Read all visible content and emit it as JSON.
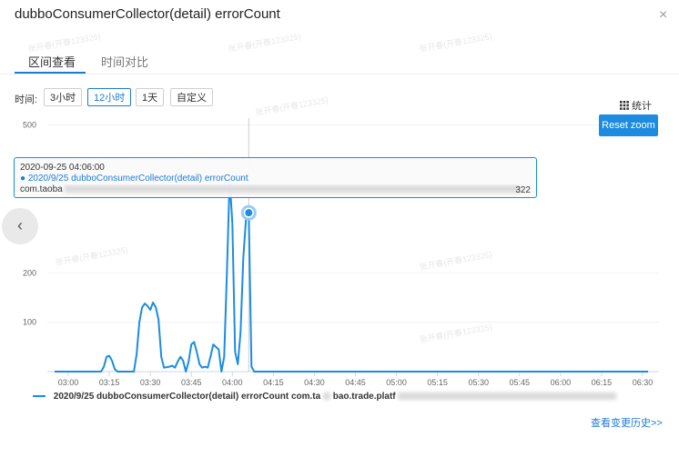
{
  "dialog": {
    "title": "dubboConsumerCollector(detail) errorCount",
    "close_glyph": "×"
  },
  "tabs": [
    {
      "label": "区间查看",
      "active": true
    },
    {
      "label": "时间对比",
      "active": false
    }
  ],
  "toolbar": {
    "time_label": "时间:",
    "ranges": [
      {
        "label": "3小时",
        "active": false
      },
      {
        "label": "12小时",
        "active": true
      },
      {
        "label": "1天",
        "active": false
      },
      {
        "label": "自定义",
        "active": false
      }
    ],
    "stats_label": "统计",
    "stats_icon": "grid-icon",
    "reset_zoom": "Reset zoom"
  },
  "nav": {
    "prev_glyph": "‹"
  },
  "chart_data": {
    "type": "line",
    "color": "#1d8ce0",
    "y_ticks": [
      "100",
      "200",
      "500"
    ],
    "x_ticks": [
      "03:00",
      "03:15",
      "03:30",
      "03:45",
      "04:00",
      "04:15",
      "04:30",
      "04:45",
      "05:00",
      "05:15",
      "05:30",
      "05:45",
      "06:00",
      "06:15",
      "06:30"
    ],
    "x_start": "02:55",
    "x_end": "06:32",
    "series": [
      {
        "name": "2020/9/25 dubboConsumerCollector(detail) errorCount com.taobao.trade.platf",
        "points": [
          [
            "02:55",
            0
          ],
          [
            "03:12",
            0
          ],
          [
            "03:13",
            10
          ],
          [
            "03:14",
            30
          ],
          [
            "03:15",
            32
          ],
          [
            "03:16",
            22
          ],
          [
            "03:17",
            5
          ],
          [
            "03:18",
            0
          ],
          [
            "03:24",
            0
          ],
          [
            "03:25",
            35
          ],
          [
            "03:26",
            100
          ],
          [
            "03:27",
            130
          ],
          [
            "03:28",
            138
          ],
          [
            "03:29",
            133
          ],
          [
            "03:30",
            125
          ],
          [
            "03:31",
            140
          ],
          [
            "03:32",
            130
          ],
          [
            "03:33",
            105
          ],
          [
            "03:34",
            30
          ],
          [
            "03:35",
            8
          ],
          [
            "03:37",
            10
          ],
          [
            "03:38",
            12
          ],
          [
            "03:39",
            8
          ],
          [
            "03:40",
            20
          ],
          [
            "03:41",
            30
          ],
          [
            "03:42",
            22
          ],
          [
            "03:43",
            0
          ],
          [
            "03:44",
            20
          ],
          [
            "03:45",
            55
          ],
          [
            "03:46",
            60
          ],
          [
            "03:47",
            40
          ],
          [
            "03:48",
            15
          ],
          [
            "03:49",
            8
          ],
          [
            "03:50",
            10
          ],
          [
            "03:51",
            8
          ],
          [
            "03:52",
            30
          ],
          [
            "03:53",
            55
          ],
          [
            "03:54",
            50
          ],
          [
            "03:55",
            45
          ],
          [
            "03:56",
            0
          ],
          [
            "03:57",
            30
          ],
          [
            "03:58",
            200
          ],
          [
            "03:59",
            390
          ],
          [
            "04:00",
            300
          ],
          [
            "04:01",
            40
          ],
          [
            "04:02",
            15
          ],
          [
            "04:03",
            80
          ],
          [
            "04:04",
            230
          ],
          [
            "04:05",
            310
          ],
          [
            "04:06",
            322
          ],
          [
            "04:07",
            10
          ],
          [
            "04:08",
            0
          ],
          [
            "06:32",
            0
          ]
        ]
      }
    ],
    "highlight": {
      "x": "04:06",
      "y": 322
    }
  },
  "tooltip": {
    "time": "2020-09-25 04:06:00",
    "series": "● 2020/9/25 dubboConsumerCollector(detail) errorCount",
    "line3_start": "com.taoba",
    "value": "322"
  },
  "legend": {
    "text": "2020/9/25 dubboConsumerCollector(detail) errorCount com.ta",
    "text2": "bao.trade.platf"
  },
  "footer": {
    "history_link": "查看变更历史>>"
  },
  "watermark": "张开春(开春123325)"
}
